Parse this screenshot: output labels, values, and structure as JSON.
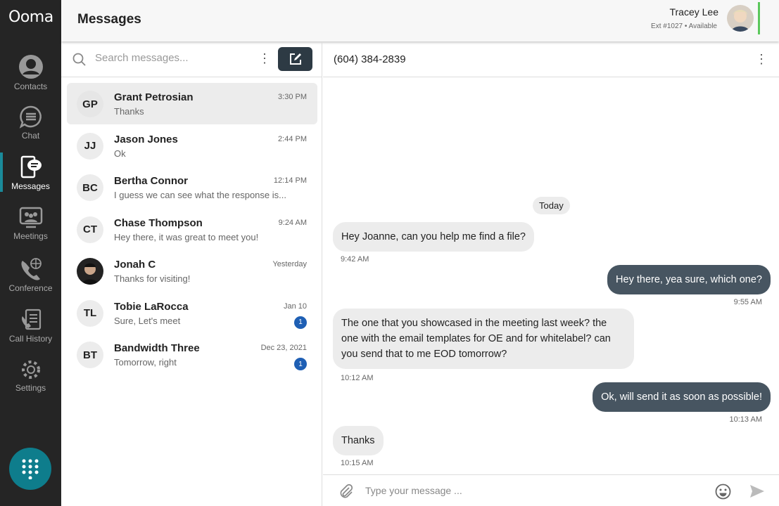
{
  "app": {
    "logo": "Ooma",
    "title": "Messages"
  },
  "sidebar": {
    "items": [
      {
        "label": "Contacts",
        "icon": "contact-icon"
      },
      {
        "label": "Chat",
        "icon": "chat-icon"
      },
      {
        "label": "Messages",
        "icon": "messages-icon",
        "active": true
      },
      {
        "label": "Meetings",
        "icon": "meetings-icon"
      },
      {
        "label": "Conference",
        "icon": "conference-icon"
      },
      {
        "label": "Call History",
        "icon": "call-history-icon"
      },
      {
        "label": "Settings",
        "icon": "gear-icon"
      }
    ],
    "dialpad_icon": "dialpad-icon"
  },
  "user": {
    "name": "Tracey Lee",
    "ext": "Ext #1027",
    "status": "Available",
    "status_color": "#5cc85c"
  },
  "search": {
    "placeholder": "Search messages..."
  },
  "conversations": [
    {
      "initials": "GP",
      "name": "Grant Petrosian",
      "preview": "Thanks",
      "time": "3:30 PM",
      "selected": true
    },
    {
      "initials": "JJ",
      "name": "Jason Jones",
      "preview": "Ok",
      "time": "2:44 PM"
    },
    {
      "initials": "BC",
      "name": "Bertha Connor",
      "preview": "I guess we can see what the response is...",
      "time": "12:14 PM"
    },
    {
      "initials": "CT",
      "name": "Chase Thompson",
      "preview": "Hey there, it was great to meet you!",
      "time": "9:24 AM"
    },
    {
      "initials": "",
      "name": "Jonah C",
      "preview": "Thanks for visiting!",
      "time": "Yesterday"
    },
    {
      "initials": "TL",
      "name": "Tobie LaRocca",
      "preview": "Sure, Let's meet",
      "time": "Jan 10",
      "unread": "1"
    },
    {
      "initials": "BT",
      "name": "Bandwidth Three",
      "preview": "Tomorrow, right",
      "time": "Dec 23, 2021",
      "unread": "1"
    }
  ],
  "chat": {
    "phone": "(604) 384-2839",
    "day": "Today",
    "messages": [
      {
        "dir": "in",
        "text": "Hey Joanne, can you help me find a file?",
        "time": "9:42 AM"
      },
      {
        "dir": "out",
        "text": "Hey there, yea sure, which one?",
        "time": "9:55 AM"
      },
      {
        "dir": "in",
        "text": "The one that you showcased in the meeting last week? the one with the email templates for OE and for whitelabel? can you send that to me EOD tomorrow?",
        "time": "10:12 AM"
      },
      {
        "dir": "out",
        "text": "Ok, will send it as soon as possible!",
        "time": "10:13 AM"
      },
      {
        "dir": "in",
        "text": "Thanks",
        "time": "10:15 AM"
      }
    ],
    "composer_placeholder": "Type your message ..."
  },
  "colors": {
    "sidebar": "#252525",
    "accent": "#0e7d8c",
    "outgoing_bubble": "#475561",
    "badge": "#1e5fb4"
  }
}
